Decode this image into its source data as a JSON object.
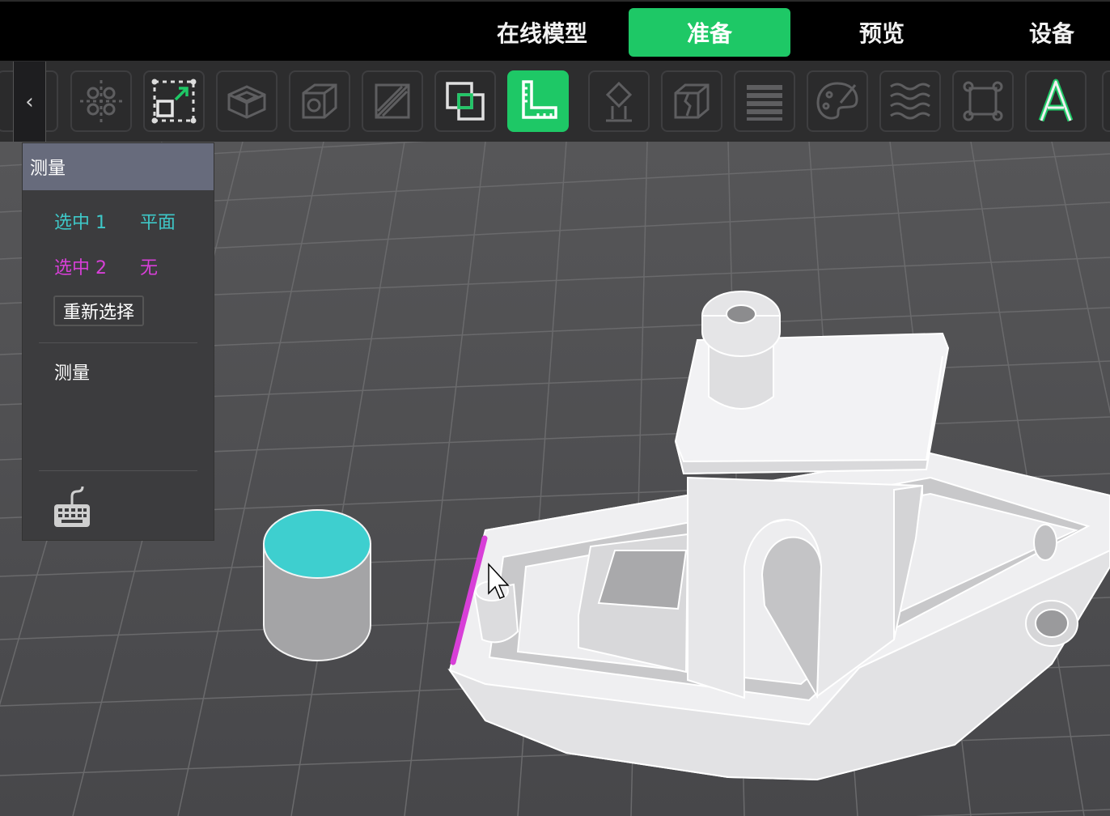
{
  "header": {
    "tabs": [
      {
        "label": "在线模型",
        "active": false
      },
      {
        "label": "准备",
        "active": true
      },
      {
        "label": "预览",
        "active": false
      },
      {
        "label": "设备",
        "active": false
      }
    ]
  },
  "toolbar": {
    "collapse_glyph": "‹",
    "tools": [
      {
        "icon": "arrange-icon",
        "active": false
      },
      {
        "icon": "scale-icon",
        "active": false
      },
      {
        "icon": "hollow-icon",
        "active": false
      },
      {
        "icon": "cube-icon",
        "active": false
      },
      {
        "icon": "cut-icon",
        "active": false
      },
      {
        "icon": "boolean-icon",
        "active": false
      },
      {
        "icon": "measure-icon",
        "active": true
      },
      {
        "icon": "support-icon",
        "active": false
      },
      {
        "icon": "split-icon",
        "active": false
      },
      {
        "icon": "layers-icon",
        "active": false
      },
      {
        "icon": "paint-icon",
        "active": false
      },
      {
        "icon": "texture-icon",
        "active": false
      },
      {
        "icon": "bounding-box-icon",
        "active": false
      },
      {
        "icon": "text-icon",
        "active": false
      }
    ]
  },
  "measure_panel": {
    "title": "测量",
    "selection1_label": "选中 1",
    "selection1_value": "平面",
    "selection2_label": "选中 2",
    "selection2_value": "无",
    "reselect_button": "重新选择",
    "measure_label": "测量"
  },
  "colors": {
    "accent": "#1ec866",
    "selection1": "#3ec8c8",
    "selection2": "#d83fd8",
    "panel_header": "#676b7c"
  }
}
